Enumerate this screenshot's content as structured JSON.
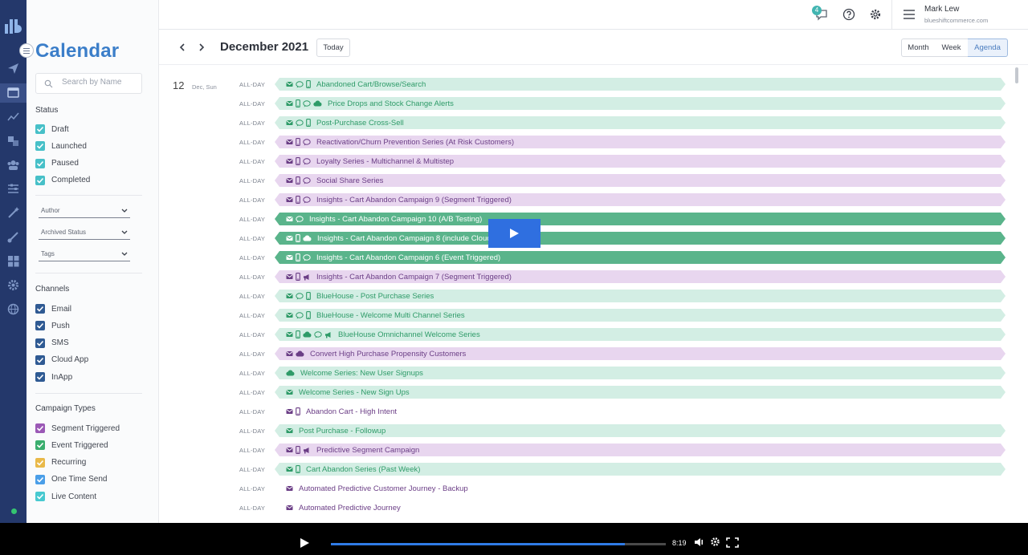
{
  "sidebar": {
    "title": "Calendar",
    "search_placeholder": "Search by Name",
    "status_heading": "Status",
    "status": [
      {
        "label": "Draft",
        "color": "#47c0c8"
      },
      {
        "label": "Launched",
        "color": "#47c0c8"
      },
      {
        "label": "Paused",
        "color": "#47c0c8"
      },
      {
        "label": "Completed",
        "color": "#47c0c8"
      }
    ],
    "filters": [
      "Author",
      "Archived Status",
      "Tags"
    ],
    "channels_heading": "Channels",
    "channels": [
      {
        "label": "Email",
        "color": "#2f5a93"
      },
      {
        "label": "Push",
        "color": "#2f5a93"
      },
      {
        "label": "SMS",
        "color": "#2f5a93"
      },
      {
        "label": "Cloud App",
        "color": "#2f5a93"
      },
      {
        "label": "InApp",
        "color": "#2f5a93"
      }
    ],
    "types_heading": "Campaign Types",
    "types": [
      {
        "label": "Segment Triggered",
        "color": "#9b59b6"
      },
      {
        "label": "Event Triggered",
        "color": "#3aae6e"
      },
      {
        "label": "Recurring",
        "color": "#e9b949"
      },
      {
        "label": "One Time Send",
        "color": "#4a9ee8"
      },
      {
        "label": "Live Content",
        "color": "#47c9d0"
      }
    ]
  },
  "topbar": {
    "notification_count": "4",
    "user_name": "Mark Lew",
    "user_org": "blueshiftcommerce.com"
  },
  "calendar": {
    "month_label": "December 2021",
    "today_label": "Today",
    "views": [
      {
        "label": "Month",
        "active": false
      },
      {
        "label": "Week",
        "active": false
      },
      {
        "label": "Agenda",
        "active": true
      }
    ],
    "day_number": "12",
    "day_name": "Dec, Sun",
    "allday_label": "ALL-DAY"
  },
  "events": [
    {
      "title": "Abandoned Cart/Browse/Search",
      "style": "lg",
      "icons": [
        "email",
        "chat",
        "phone"
      ]
    },
    {
      "title": "Price Drops and Stock Change Alerts",
      "style": "lg",
      "icons": [
        "email",
        "phone",
        "chat",
        "cloud"
      ]
    },
    {
      "title": "Post-Purchase Cross-Sell",
      "style": "lg",
      "icons": [
        "email",
        "chat",
        "phone"
      ]
    },
    {
      "title": "Reactivation/Churn Prevention Series (At Risk Customers)",
      "style": "lp",
      "icons": [
        "email",
        "phone",
        "chat"
      ]
    },
    {
      "title": "Loyalty Series - Multichannel & Multistep",
      "style": "lp",
      "icons": [
        "email",
        "phone",
        "chat"
      ]
    },
    {
      "title": "Social Share Series",
      "style": "lp",
      "icons": [
        "email",
        "phone",
        "chat"
      ]
    },
    {
      "title": "Insights - Cart Abandon Campaign 9 (Segment Triggered)",
      "style": "lp",
      "icons": [
        "email",
        "phone",
        "chat"
      ]
    },
    {
      "title": "Insights - Cart Abandon Campaign 10 (A/B Testing)",
      "style": "dg",
      "icons": [
        "email",
        "chat"
      ]
    },
    {
      "title": "Insights - Cart Abandon Campaign 8 (include Cloud A",
      "style": "dg",
      "icons": [
        "email",
        "phone",
        "cloud"
      ]
    },
    {
      "title": "Insights - Cart Abandon Campaign 6 (Event Triggered)",
      "style": "dg",
      "icons": [
        "email",
        "phone",
        "chat"
      ]
    },
    {
      "title": "Insights - Cart Abandon Campaign 7 (Segment Triggered)",
      "style": "lp",
      "icons": [
        "email",
        "phone",
        "megaphone"
      ]
    },
    {
      "title": "BlueHouse - Post Purchase Series",
      "style": "lg",
      "icons": [
        "email",
        "chat",
        "phone"
      ]
    },
    {
      "title": "BlueHouse - Welcome Multi Channel Series",
      "style": "lg",
      "icons": [
        "email",
        "chat",
        "phone"
      ]
    },
    {
      "title": "BlueHouse Omnichannel Welcome Series",
      "style": "lg",
      "icons": [
        "email",
        "phone",
        "cloud",
        "chat",
        "megaphone"
      ]
    },
    {
      "title": "Convert High Purchase Propensity Customers",
      "style": "lp",
      "icons": [
        "email",
        "cloud"
      ]
    },
    {
      "title": "Welcome Series: New User Signups",
      "style": "lg",
      "icons": [
        "cloud"
      ]
    },
    {
      "title": "Welcome Series - New Sign Ups",
      "style": "lg",
      "icons": [
        "email"
      ]
    },
    {
      "title": "Abandon Cart - High Intent",
      "style": "none",
      "icons": [
        "email",
        "phone"
      ]
    },
    {
      "title": "Post Purchase - Followup",
      "style": "lg",
      "icons": [
        "email"
      ]
    },
    {
      "title": "Predictive Segment Campaign",
      "style": "lp",
      "icons": [
        "email",
        "phone",
        "megaphone"
      ]
    },
    {
      "title": "Cart Abandon Series (Past Week)",
      "style": "lg",
      "icons": [
        "email",
        "phone"
      ]
    },
    {
      "title": "Automated Predictive Customer Journey - Backup",
      "style": "none",
      "icons": [
        "email"
      ]
    },
    {
      "title": "Automated Predictive Journey",
      "style": "none",
      "icons": [
        "email"
      ]
    }
  ],
  "player": {
    "time": "8:19",
    "progress": 0.877
  }
}
